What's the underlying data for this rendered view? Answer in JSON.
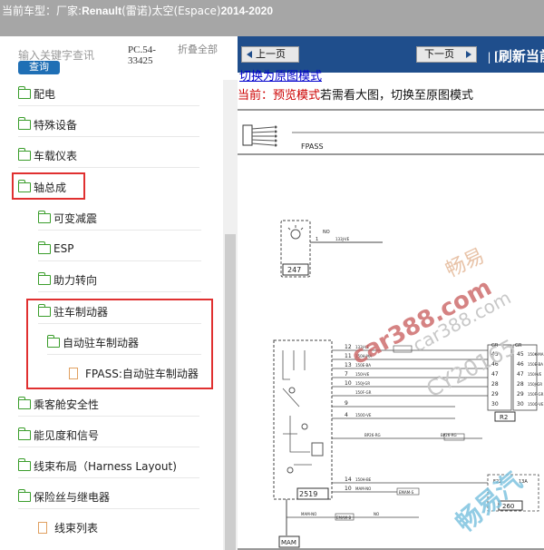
{
  "header": {
    "label": "当前车型：",
    "manufacturer_label": "厂家:",
    "brand": "Renault",
    "brand_cn": "(雷诺)",
    "model": "太空(Espace)",
    "years": "2014-2020"
  },
  "search": {
    "placeholder": "输入关键字查讯",
    "button": "查询",
    "pc_code": "PC.54-33425",
    "collapse_all": "折叠全部"
  },
  "tree": [
    {
      "label": "配电",
      "type": "folder"
    },
    {
      "label": "特殊设备",
      "type": "folder"
    },
    {
      "label": "车载仪表",
      "type": "folder"
    },
    {
      "label": "轴总成",
      "type": "folder"
    },
    {
      "label": "可变减震",
      "type": "folder"
    },
    {
      "label": "ESP",
      "type": "folder"
    },
    {
      "label": "助力转向",
      "type": "folder"
    },
    {
      "label": "驻车制动器",
      "type": "folder"
    },
    {
      "label": "自动驻车制动器",
      "type": "folder"
    },
    {
      "label": "FPASS:自动驻车制动器",
      "type": "doc"
    },
    {
      "label": "乘客舱安全性",
      "type": "folder"
    },
    {
      "label": "能见度和信号",
      "type": "folder"
    },
    {
      "label": "线束布局（Harness Layout)",
      "type": "folder"
    },
    {
      "label": "保险丝与继电器",
      "type": "folder"
    },
    {
      "label": "线束列表",
      "type": "doc"
    }
  ],
  "nav": {
    "prev": "上一页",
    "next": "下一页",
    "separator": "|",
    "refresh": "[刷新当前"
  },
  "viewer": {
    "switch_link": "切换为原图模式",
    "current_label": "当前：预览模式",
    "current_hint": "若需看大图，切换至原图模式"
  },
  "diagram": {
    "title": "FPASS",
    "components": [
      "247",
      "2519",
      "R2",
      "260",
      "MAM"
    ],
    "wire_labels": [
      "NO",
      "133J-VE",
      "133J-VE",
      "150H-MA",
      "150E-BA",
      "150I-VE",
      "150J-GR",
      "150F-GR",
      "150O-VE",
      "150H-BE",
      "150K-MA",
      "150E-BA",
      "150I-VE",
      "150J-GR",
      "150F-GR",
      "150O-VE",
      "BP26-RG",
      "BP26-RG",
      "MAM-NO",
      "MAM-NO",
      "EMAM-S",
      "EMAM-B",
      "NO",
      "GR",
      "GR"
    ],
    "pins_left": [
      "1",
      "12",
      "11",
      "13",
      "7",
      "10",
      "9",
      "4",
      "14",
      "10"
    ],
    "pins_r2": [
      "45",
      "46",
      "47",
      "28",
      "29",
      "30"
    ],
    "pins_r2b": [
      "45",
      "46",
      "47",
      "28",
      "29",
      "30"
    ],
    "pins_260": [
      "F22",
      "13A"
    ]
  },
  "watermarks": [
    "畅易",
    "car388.com",
    "car388.com",
    "CY20165",
    "畅易汽"
  ]
}
